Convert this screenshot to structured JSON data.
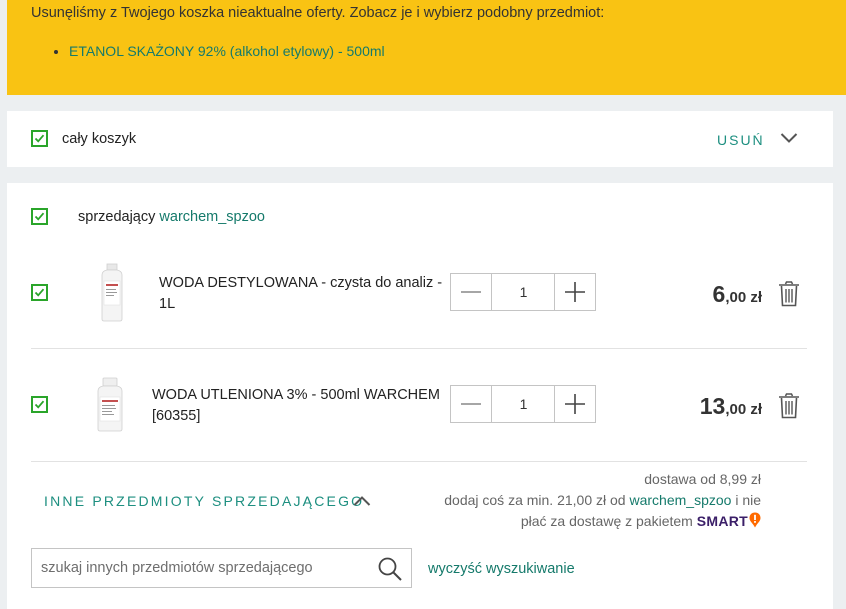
{
  "notice": {
    "message": "Usunęliśmy z Twojego koszka nieaktualne oferty. Zobacz je i wybierz podobny przedmiot:",
    "items": [
      "ETANOL SKAŻONY 92% (alkohol etylowy) - 500ml"
    ]
  },
  "cart": {
    "select_all_label": "cały koszyk",
    "select_all_checked": true,
    "remove_label": "USUŃ",
    "expand_icon": "chevron-down-icon"
  },
  "seller": {
    "prefix": "sprzedający",
    "name": "warchem_spzoo",
    "checked": true,
    "products": [
      {
        "name_line1": "WODA DESTYLOWANA - czysta do analiz -",
        "name_line2": "1L",
        "quantity": "1",
        "price_int": "6",
        "price_dec": ",00 zł",
        "checked": true
      },
      {
        "name_line1": "WODA UTLENIONA 3% - 500ml WARCHEM",
        "name_line2": "[60355]",
        "quantity": "1",
        "price_int": "13",
        "price_dec": ",00 zł",
        "checked": true
      }
    ],
    "other_items_label": "INNE PRZEDMIOTY SPRZEDAJĄCEGO",
    "delivery": {
      "line1": "dostawa od 8,99 zł",
      "line2_prefix": "dodaj coś za min. 21,00 zł od",
      "line2_seller": "warchem_spzoo",
      "line2_suffix": "i nie",
      "line3": "płać za dostawę z pakietem",
      "smart": "SMART"
    },
    "search": {
      "placeholder": "szukaj innych przedmiotów sprzedającego",
      "value": ""
    },
    "clear_search_label": "wyczyść wyszukiwanie"
  },
  "colors": {
    "notice_bg": "#f9c313",
    "accent_green": "#157a6b",
    "checkbox_green": "#2aa52a",
    "smart_purple": "#3b1f68",
    "smart_orange": "#ff6a00"
  }
}
